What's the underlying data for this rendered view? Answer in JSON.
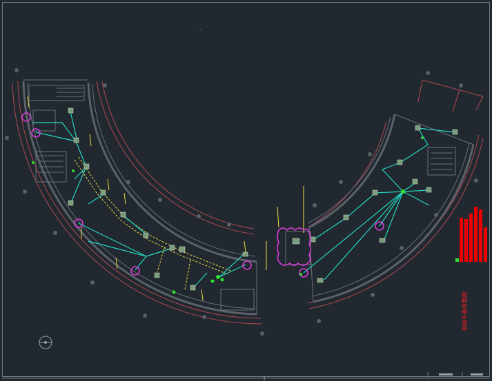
{
  "canvas": {
    "background": "#212830"
  },
  "colors": {
    "wire": "#25d6c2",
    "cable_tray": "#f0e040",
    "camera_symbol": "#d63cd6",
    "wall": "#6b7078",
    "axis_line": "#b04a52",
    "title_block": "#ee0000"
  },
  "legend_block": {
    "text": "弱电平面布置图"
  },
  "icons": [
    "north-arrow-icon",
    "camera-icon",
    "device-box-icon"
  ]
}
